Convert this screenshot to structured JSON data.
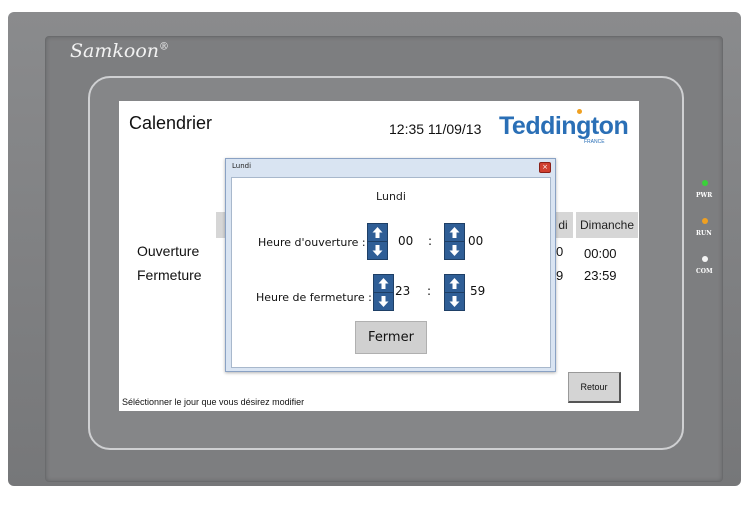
{
  "device": {
    "brand": "Samkoon",
    "brand_mark": "®",
    "leds": [
      {
        "label": "PWR",
        "color": "#3ad23a"
      },
      {
        "label": "RUN",
        "color": "#f0a020"
      },
      {
        "label": "COM",
        "color": "#f4f4f4"
      }
    ]
  },
  "screen": {
    "title": "Calendrier",
    "clock": "12:35 11/09/13",
    "logo": "Teddington",
    "logo_sub": "FRANCE",
    "columns": [
      "di",
      "Dimanche"
    ],
    "rows": [
      {
        "label": "Ouverture",
        "partial": "0",
        "dimanche": "00:00"
      },
      {
        "label": "Fermeture",
        "partial": "9",
        "dimanche": "23:59"
      }
    ],
    "status": "Séléctionner le jour que vous désirez modifier",
    "retour_label": "Retour"
  },
  "dialog": {
    "window_title": "Lundi",
    "close_glyph": "×",
    "heading": "Lundi",
    "opening_label": "Heure d'ouverture :",
    "opening_hour": "00",
    "opening_minute": "00",
    "closing_label": "Heure de fermeture :",
    "closing_hour": "23",
    "closing_minute": "59",
    "separator": ":",
    "close_button": "Fermer"
  },
  "colors": {
    "accent": "#2f5e96",
    "logo": "#2a6fb6"
  }
}
